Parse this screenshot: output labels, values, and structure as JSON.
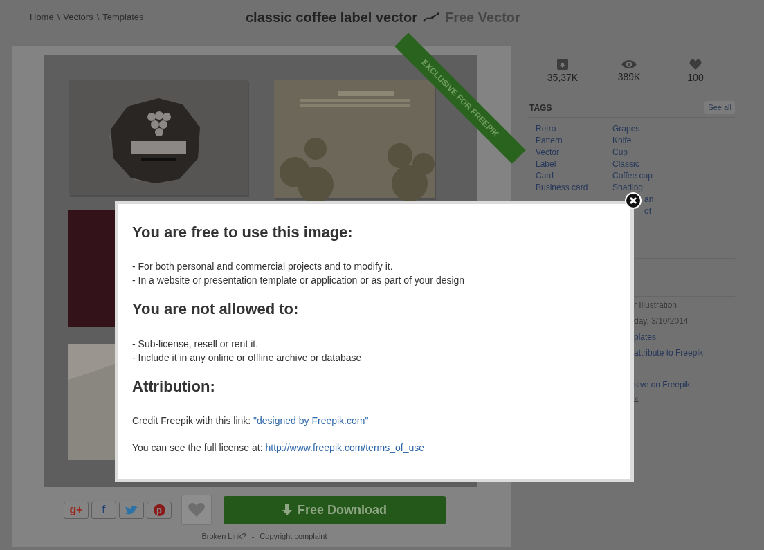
{
  "breadcrumb": {
    "items": [
      "Home",
      "Vectors",
      "Templates"
    ],
    "separator": "\\"
  },
  "title": "classic coffee label vector",
  "type_label": "Free Vector",
  "ribbon": "EXCLUSIVE FOR FREEPIK",
  "share_buttons": [
    {
      "kind": "gplus",
      "label": "g+"
    },
    {
      "kind": "facebook",
      "label": "f"
    },
    {
      "kind": "twitter"
    },
    {
      "kind": "pinterest",
      "label": "p"
    }
  ],
  "download_button": "Free Download",
  "footer_links": {
    "items": [
      "Broken Link?",
      "Copyright complaint"
    ],
    "separator": "-"
  },
  "stats": [
    {
      "kind": "downloads",
      "value": "35,37K"
    },
    {
      "kind": "views",
      "value": "389K"
    },
    {
      "kind": "likes",
      "value": "100"
    }
  ],
  "tags": {
    "title": "TAGS",
    "see_all": "See all",
    "column_1": [
      {
        "text": "Retro"
      },
      {
        "text": "Pattern"
      },
      {
        "text": "Vector"
      },
      {
        "text": "Label"
      },
      {
        "text": "Card"
      },
      {
        "text": "Business card"
      }
    ],
    "column_2": [
      {
        "text": "Grapes"
      },
      {
        "text": "Knife"
      },
      {
        "text": "Cup"
      },
      {
        "text": "Classic"
      },
      {
        "text": "Coffee cup"
      },
      {
        "text": "Shading"
      },
      {
        "text": "an",
        "cut": true
      },
      {
        "text": "of",
        "cut": true
      }
    ]
  },
  "details": [
    {
      "kind": "plain",
      "text": "r Illustration"
    },
    {
      "kind": "plain",
      "text": "day, 3/10/2014"
    },
    {
      "kind": "link",
      "text": "plates"
    },
    {
      "kind": "link",
      "text": "attribute to Freepik"
    },
    {
      "kind": "link",
      "text": "sive on Freepik",
      "gap_before": true
    },
    {
      "kind": "plain",
      "text": "4"
    }
  ],
  "license_modal": {
    "sections": [
      {
        "heading": "You are free to use this image:",
        "paragraphs": [
          {
            "lines": [
              {
                "text": "- For both personal and commercial projects and to modify it."
              },
              {
                "text": "- In a website or presentation template or application or as part of your design"
              }
            ]
          }
        ]
      },
      {
        "heading": "You are not allowed to:",
        "paragraphs": [
          {
            "lines": [
              {
                "text": "- Sub-license, resell or rent it."
              },
              {
                "text": "- Include it in any online or offline archive or database"
              }
            ]
          }
        ]
      },
      {
        "heading": "Attribution:",
        "paragraphs": [
          {
            "lines": [
              {
                "text": "Credit Freepik with this link: ",
                "link": "\"designed by Freepik.com\""
              }
            ]
          },
          {
            "lines": [
              {
                "text": "You can see the full license at: ",
                "link": "http://www.freepik.com/terms_of_use"
              }
            ]
          }
        ]
      }
    ]
  }
}
